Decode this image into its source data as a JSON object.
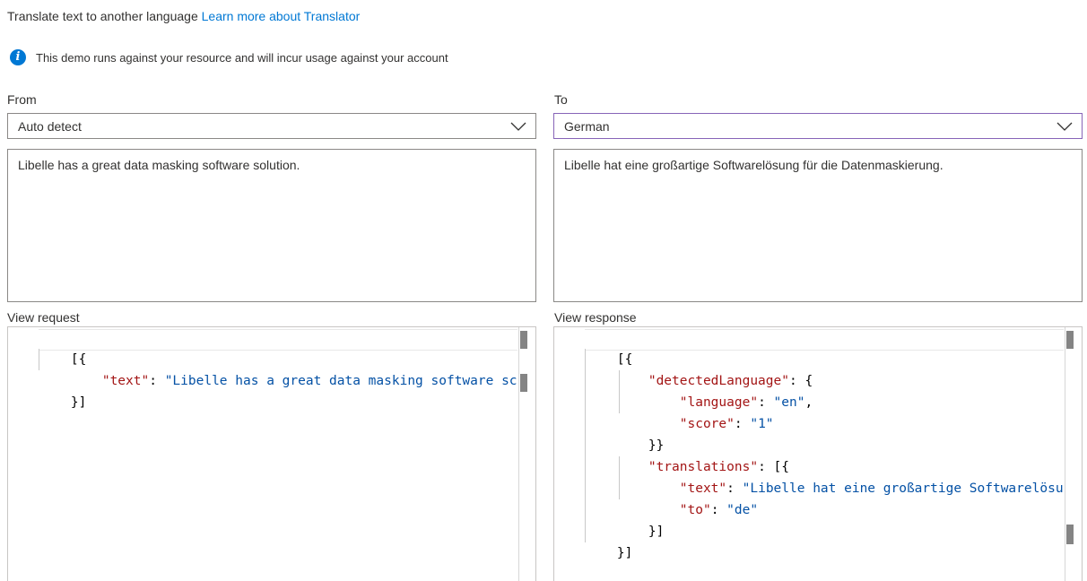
{
  "header": {
    "intro_text": "Translate text to another language",
    "learn_more_link": "Learn more about Translator"
  },
  "info": {
    "icon": "info-icon",
    "message": "This demo runs against your resource and will incur usage against your account"
  },
  "from": {
    "label": "From",
    "selected": "Auto detect",
    "input_text": "Libelle has a great data masking software solution."
  },
  "to": {
    "label": "To",
    "selected": "German",
    "output_text": "Libelle hat eine großartige Softwarelösung für die Datenmaskierung."
  },
  "request": {
    "label": "View request",
    "lines": [
      {
        "open": "[{"
      },
      {
        "key": "\"text\"",
        "colon": ": ",
        "val": "\"Libelle has a great data masking software sc"
      },
      {
        "close": "}]"
      }
    ]
  },
  "response": {
    "label": "View response",
    "lines": [
      {
        "p": "[{"
      },
      {
        "k": "\"detectedLanguage\"",
        "p": ": {"
      },
      {
        "k": "\"language\"",
        "p1": ": ",
        "v": "\"en\"",
        "p2": ","
      },
      {
        "k": "\"score\"",
        "p1": ": ",
        "v": "\"1\""
      },
      {
        "p": "}}"
      },
      {
        "k": "\"translations\"",
        "p": ": [{"
      },
      {
        "k": "\"text\"",
        "p1": ": ",
        "v": "\"Libelle hat eine großartige Softwarelösu"
      },
      {
        "k": "\"to\"",
        "p1": ": ",
        "v": "\"de\""
      },
      {
        "p": "}]"
      },
      {
        "p": "}]"
      }
    ]
  },
  "colors": {
    "link": "#0078d4",
    "json_key": "#a31515",
    "json_string": "#0451a5",
    "focus_border": "#8764b8"
  }
}
